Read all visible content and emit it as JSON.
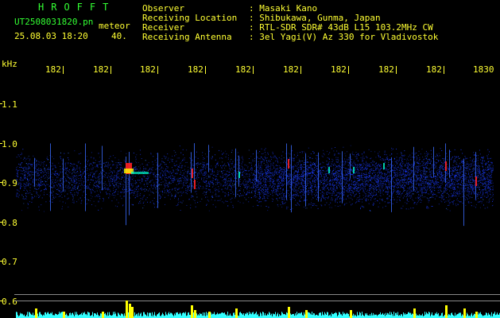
{
  "header": {
    "logo": "HROFFT",
    "filename": "UT2508031820.pn",
    "mode": "meteor",
    "datetime": "25.08.03 18:20",
    "count": "40.",
    "labels": [
      "Observer",
      "Receiving Location",
      "Receiver",
      "Receiving Antenna"
    ],
    "values": [
      ": Masaki Kano",
      ": Shibukawa, Gunma, Japan",
      ": RTL-SDR SDR# 43dB L15 103.2MHz CW",
      ": 3el Yagi(V) Az 330 for Vladivostok"
    ]
  },
  "axis": {
    "unit": "kHz",
    "y_ticks": [
      "1.1",
      "1.0",
      "0.9",
      "0.8",
      "0.7",
      "0.6"
    ],
    "x_ticks": [
      "182",
      "182",
      "182",
      "182",
      "182",
      "182",
      "182",
      "182",
      "182",
      "1830"
    ]
  },
  "colors": {
    "text_yellow": "#ffff33",
    "logo_green": "#33ff33",
    "noise_blue": "#1a3aff",
    "echo_red": "#ff2020",
    "histogram_cyan": "#33ffff",
    "histogram_yellow": "#ffff00"
  }
}
